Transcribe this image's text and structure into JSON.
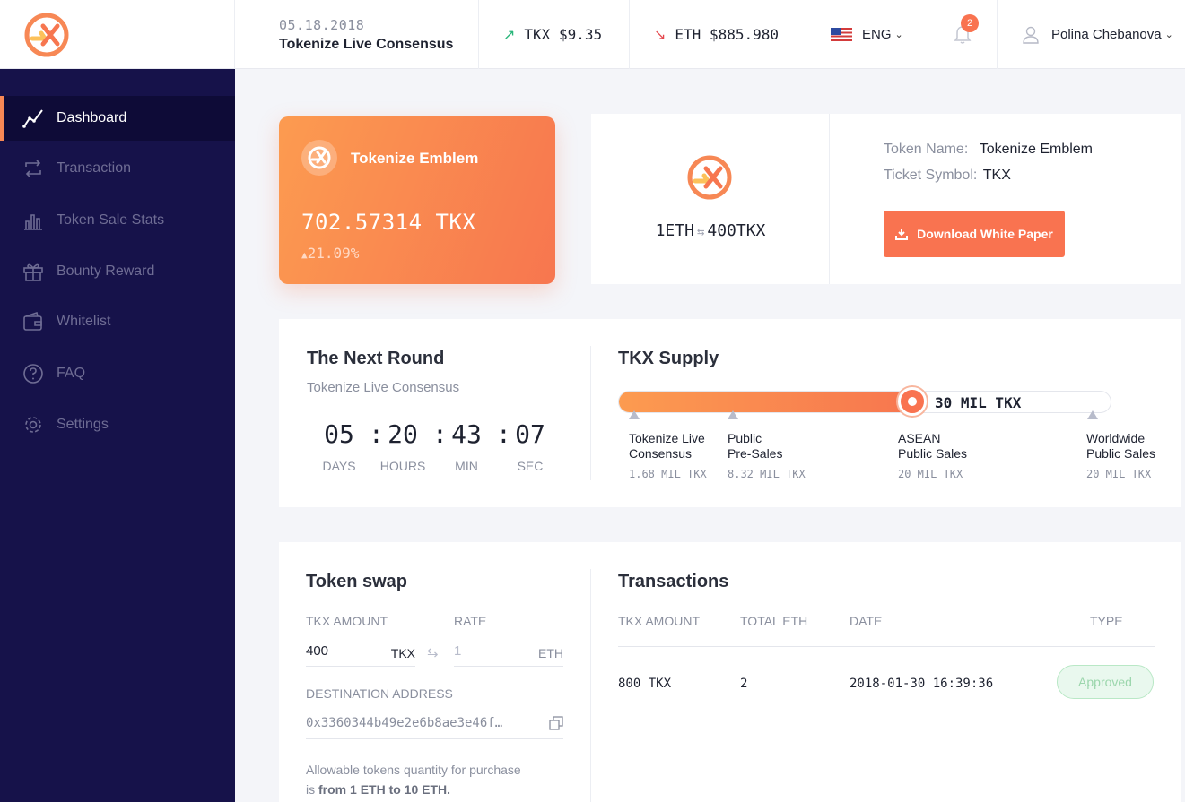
{
  "header": {
    "date": "05.18.2018",
    "event_title": "Tokenize Live Consensus",
    "tkx_price": "TKX $9.35",
    "eth_price": "ETH $885.980",
    "language": "ENG",
    "notifications_count": "2",
    "user_name": "Polina Chebanova",
    "colors": {
      "up": "#29b67a",
      "down": "#e5484d",
      "accent": "#f97350"
    }
  },
  "sidebar": {
    "items": [
      {
        "label": "Dashboard",
        "icon": "chart-line-icon",
        "active": true
      },
      {
        "label": "Transaction",
        "icon": "repeat-icon"
      },
      {
        "label": "Token Sale Stats",
        "icon": "bar-chart-icon"
      },
      {
        "label": "Bounty Reward",
        "icon": "gift-icon"
      },
      {
        "label": "Whitelist",
        "icon": "wallet-icon"
      },
      {
        "label": "FAQ",
        "icon": "question-icon"
      },
      {
        "label": "Settings",
        "icon": "gear-icon"
      }
    ]
  },
  "emblem": {
    "name": "Tokenize Emblem",
    "amount": "702.57314 TKX",
    "change": "21.09%"
  },
  "token_info": {
    "rate_left": "1ETH",
    "rate_right": "400TKX",
    "token_name_label": "Token Name:",
    "token_name": "Tokenize Emblem",
    "symbol_label": "Ticket Symbol:",
    "symbol": "TKX",
    "download_label": "Download White Paper"
  },
  "next_round": {
    "title": "The Next Round",
    "subtitle": "Tokenize Live Consensus",
    "days": "05",
    "hours": "20",
    "minutes": "43",
    "seconds": "07",
    "days_label": "DAYS",
    "hours_label": "HOURS",
    "minutes_label": "MIN",
    "seconds_label": "SEC"
  },
  "supply": {
    "title": "TKX Supply",
    "current": "30 MIL TKX",
    "progress_fraction": 0.6,
    "milestones": [
      {
        "name": "Tokenize Live\nConsensus",
        "value": "1.68 MIL TKX"
      },
      {
        "name": "Public\nPre-Sales",
        "value": "8.32 MIL TKX"
      },
      {
        "name": "ASEAN\nPublic Sales",
        "value": "20 MIL TKX"
      },
      {
        "name": "Worldwide\nPublic Sales",
        "value": "20 MIL TKX"
      }
    ]
  },
  "swap": {
    "title": "Token swap",
    "amount_label": "TKX AMOUNT",
    "rate_label": "RATE",
    "amount_value": "400",
    "amount_unit": "TKX",
    "rate_placeholder": "1",
    "rate_unit": "ETH",
    "address_label": "DESTINATION ADDRESS",
    "address_value": "0x3360344b49e2e6b8ae3e46f…",
    "hint_prefix": "Allowable tokens quantity for purchase",
    "hint_is": "is",
    "hint_range": "from 1 ETH to 10 ETH."
  },
  "transactions": {
    "title": "Transactions",
    "columns": [
      "TKX AMOUNT",
      "TOTAL ETH",
      "DATE",
      "TYPE"
    ],
    "rows": [
      {
        "amount": "800 TKX",
        "eth": "2",
        "date": "2018-01-30 16:39:36",
        "status": "Approved"
      }
    ]
  }
}
